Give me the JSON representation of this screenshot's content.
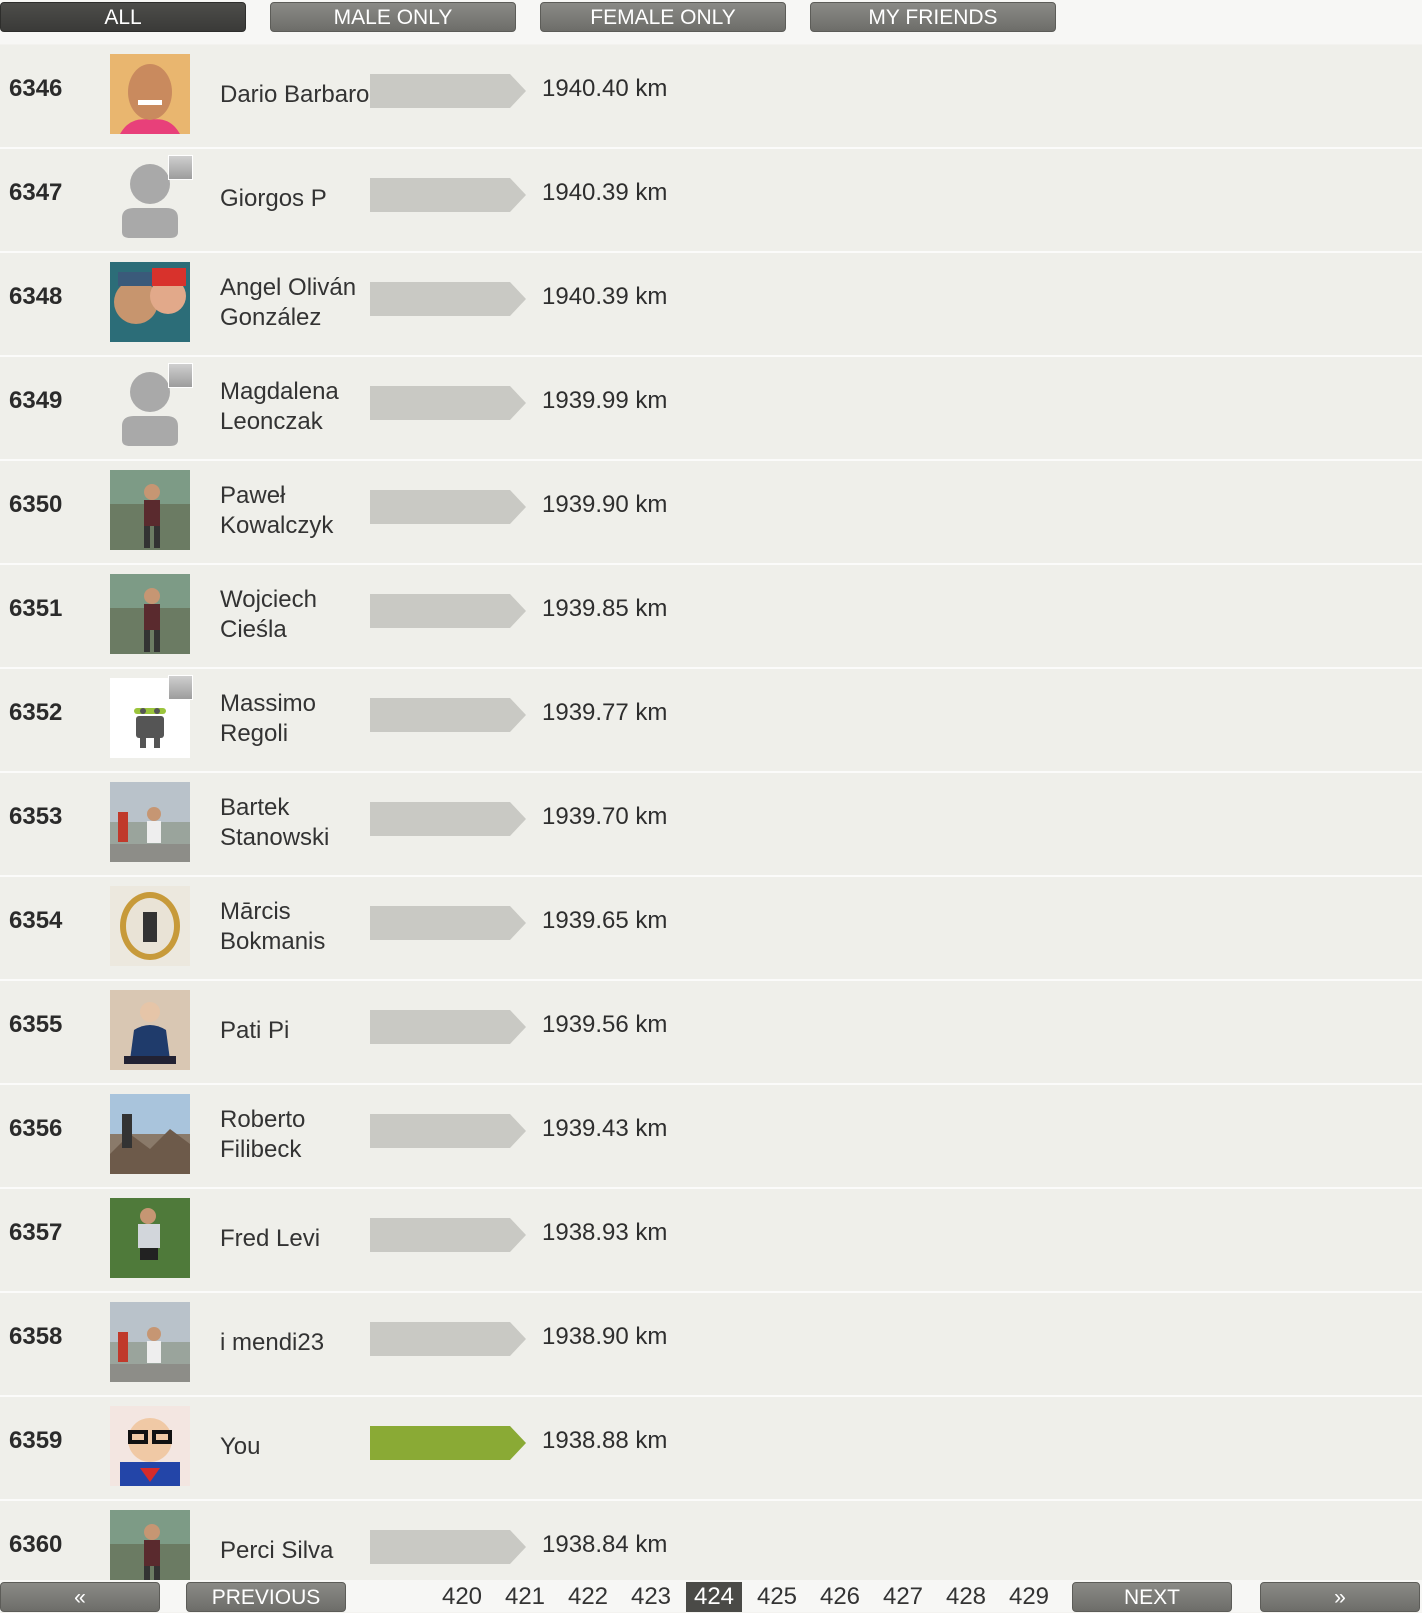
{
  "filters": {
    "all": "ALL",
    "male": "MALE ONLY",
    "female": "FEMALE ONLY",
    "friends": "MY FRIENDS"
  },
  "rows": [
    {
      "rank": "6346",
      "name": "Dario Barbaro",
      "distance": "1940.40 km",
      "avatar": "photo-portrait-icon"
    },
    {
      "rank": "6347",
      "name": "Giorgos P",
      "distance": "1940.39 km",
      "avatar": "default-user-icon"
    },
    {
      "rank": "6348",
      "name": "Angel Oliván González",
      "distance": "1940.39 km",
      "avatar": "photo-selfie-icon"
    },
    {
      "rank": "6349",
      "name": "Magdalena Leonczak",
      "distance": "1939.99 km",
      "avatar": "default-user-icon"
    },
    {
      "rank": "6350",
      "name": "Paweł Kowalczyk",
      "distance": "1939.90 km",
      "avatar": "photo-runner-icon"
    },
    {
      "rank": "6351",
      "name": "Wojciech Cieśla",
      "distance": "1939.85 km",
      "avatar": "photo-runner-icon"
    },
    {
      "rank": "6352",
      "name": "Massimo Regoli",
      "distance": "1939.77 km",
      "avatar": "android-robot-icon"
    },
    {
      "rank": "6353",
      "name": "Bartek Stanowski",
      "distance": "1939.70 km",
      "avatar": "photo-race-icon"
    },
    {
      "rank": "6354",
      "name": "Mārcis Bokmanis",
      "distance": "1939.65 km",
      "avatar": "photo-mirror-icon"
    },
    {
      "rank": "6355",
      "name": "Pati Pi",
      "distance": "1939.56 km",
      "avatar": "photo-sitting-icon"
    },
    {
      "rank": "6356",
      "name": "Roberto Filibeck",
      "distance": "1939.43 km",
      "avatar": "photo-mountain-icon"
    },
    {
      "rank": "6357",
      "name": "Fred Levi",
      "distance": "1938.93 km",
      "avatar": "photo-trail-icon"
    },
    {
      "rank": "6358",
      "name": "i mendi23",
      "distance": "1938.90 km",
      "avatar": "photo-race-icon"
    },
    {
      "rank": "6359",
      "name": "You",
      "distance": "1938.88 km",
      "avatar": "photo-kid-superman-icon",
      "highlight": true
    },
    {
      "rank": "6360",
      "name": "Perci Silva",
      "distance": "1938.84 km",
      "avatar": "photo-runner-icon"
    }
  ],
  "pager": {
    "first": "«",
    "previous": "PREVIOUS",
    "pages": [
      "420",
      "421",
      "422",
      "423",
      "424",
      "425",
      "426",
      "427",
      "428",
      "429"
    ],
    "current": "424",
    "next": "NEXT",
    "last": "»"
  },
  "colors": {
    "bar_default": "#c9c9c4",
    "bar_you": "#8aaa35",
    "tab": "#7a7a76",
    "tab_active": "#444441"
  }
}
